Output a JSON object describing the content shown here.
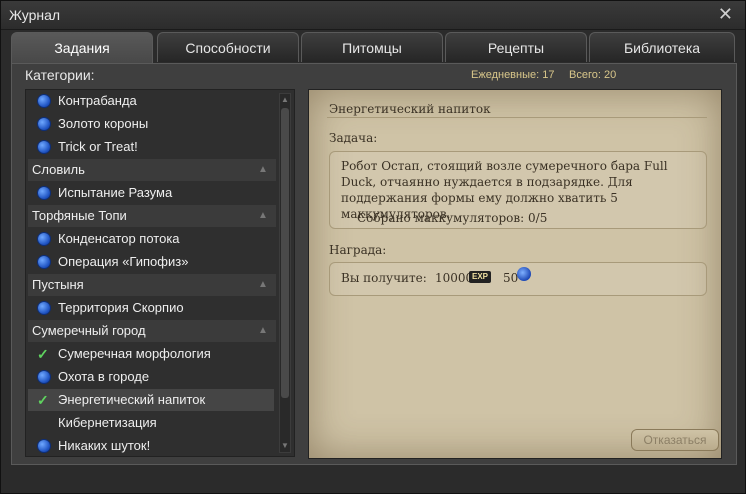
{
  "window": {
    "title": "Журнал"
  },
  "tabs": [
    {
      "label": "Задания"
    },
    {
      "label": "Способности"
    },
    {
      "label": "Питомцы"
    },
    {
      "label": "Рецепты"
    },
    {
      "label": "Библиотека"
    }
  ],
  "sidebar": {
    "label": "Категории:",
    "rows": [
      {
        "kind": "quest",
        "status": "active",
        "label": "Контрабанда"
      },
      {
        "kind": "quest",
        "status": "active",
        "label": "Золото короны"
      },
      {
        "kind": "quest",
        "status": "active",
        "label": "Trick or Treat!"
      },
      {
        "kind": "header",
        "label": "Словиль"
      },
      {
        "kind": "quest",
        "status": "active",
        "label": "Испытание Разума"
      },
      {
        "kind": "header",
        "label": "Торфяные Топи"
      },
      {
        "kind": "quest",
        "status": "active",
        "label": "Конденсатор потока"
      },
      {
        "kind": "quest",
        "status": "active",
        "label": "Операция «Гипофиз»"
      },
      {
        "kind": "header",
        "label": "Пустыня"
      },
      {
        "kind": "quest",
        "status": "active",
        "label": "Территория Скорпио"
      },
      {
        "kind": "header",
        "label": "Сумеречный город"
      },
      {
        "kind": "quest",
        "status": "done",
        "label": "Сумеречная морфология"
      },
      {
        "kind": "quest",
        "status": "active",
        "label": "Охота в городе"
      },
      {
        "kind": "quest",
        "status": "done",
        "label": "Энергетический напиток",
        "selected": true
      },
      {
        "kind": "quest",
        "status": "none",
        "label": "Кибернетизация"
      },
      {
        "kind": "quest",
        "status": "active",
        "label": "Никаких шуток!"
      }
    ]
  },
  "counts": {
    "daily": "Ежедневные: 17",
    "total": "Всего: 20"
  },
  "detail": {
    "title": "Энергетический напиток",
    "task_label": "Задача:",
    "description": "Робот Остап, стоящий возле сумеречного бара Full Duck, отчаянно нуждается в подзарядке. Для поддержания формы ему должно хватить 5 маккумуляторов.",
    "progress": "Собрано маккумуляторов: 0/5",
    "reward_label": "Награда:",
    "reward_prefix": "Вы получите:",
    "reward_exp": "10000",
    "exp_badge": "EXP",
    "reward_energy": "50"
  },
  "actions": {
    "decline": "Отказаться"
  },
  "colors": {
    "accent": "#d8c68a",
    "parchment": "#cfc3a6"
  }
}
